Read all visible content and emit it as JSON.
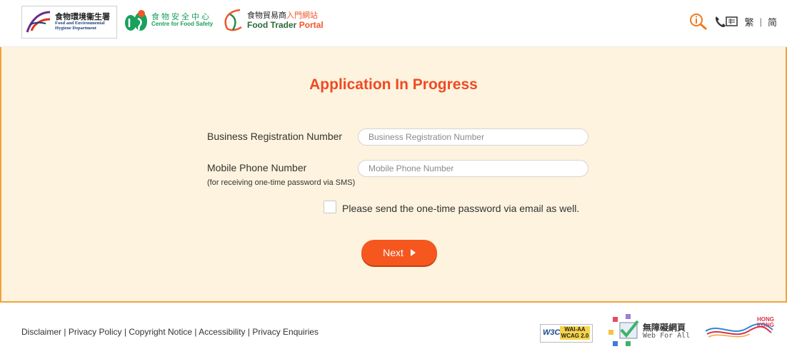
{
  "header": {
    "fehd_logo": {
      "zh": "食物環境衞生署",
      "en_line1": "Food and Environmental",
      "en_line2": "Hygiene Department"
    },
    "cfs_logo": {
      "zh": "食物安全中心",
      "en": "Centre for Food Safety"
    },
    "ftp_logo": {
      "zh_main": "食物貿易商",
      "zh_accent": "入門網站",
      "en_main": "Food Trader",
      "en_accent": "Portal"
    },
    "lang_traditional": "繁",
    "lang_separator": "|",
    "lang_simplified": "简"
  },
  "form": {
    "title": "Application In Progress",
    "brn_label": "Business Registration Number",
    "brn_placeholder": "Business Registration Number",
    "brn_value": "",
    "mobile_label": "Mobile Phone Number",
    "mobile_sublabel": "(for receiving one-time password via SMS)",
    "mobile_placeholder": "Mobile Phone Number",
    "mobile_value": "",
    "email_otp_label": "Please send the one-time password via email as well.",
    "email_otp_checked": false,
    "next_label": "Next"
  },
  "footer": {
    "links": [
      "Disclaimer",
      "Privacy Policy",
      "Copyright Notice",
      "Accessibility",
      "Privacy Enquiries"
    ],
    "separator": "|",
    "w3c_badge": {
      "w3c": "W3C",
      "wai": "WAI-AA",
      "wcag": "WCAG 2.0"
    },
    "web_for_all": {
      "zh": "無障礙網頁",
      "en": "Web For All"
    },
    "brand_hk": {
      "line1": "HONG",
      "line2": "KONG"
    }
  },
  "colors": {
    "accent": "#ef4a23",
    "button": "#f5571e",
    "panel_bg": "#fdf3de",
    "frame": "#f0a33c"
  }
}
